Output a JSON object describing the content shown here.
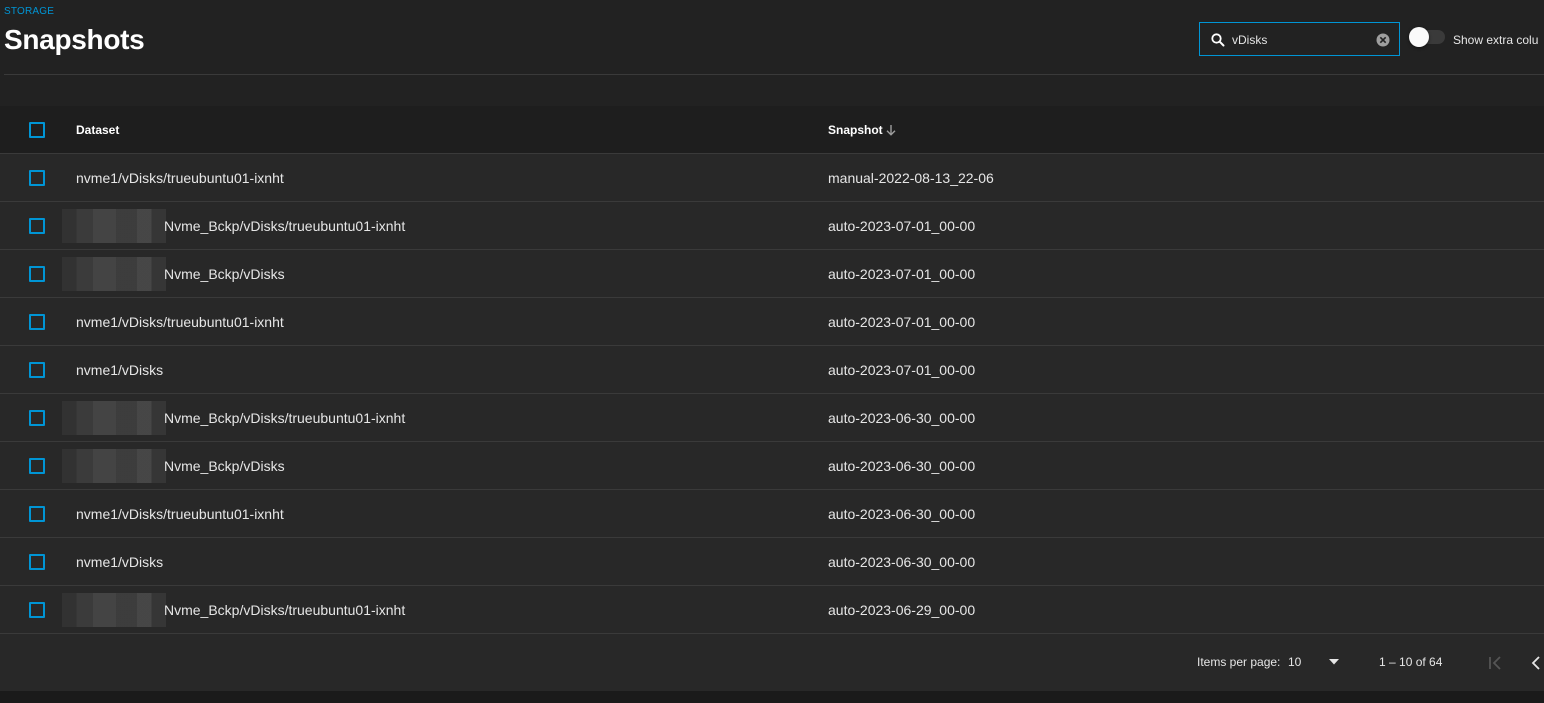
{
  "header": {
    "breadcrumb": "STORAGE",
    "title": "Snapshots"
  },
  "search": {
    "value": "vDisks",
    "placeholder": "Search"
  },
  "toggle": {
    "label": "Show extra colu",
    "checked": false
  },
  "table": {
    "columns": {
      "dataset": "Dataset",
      "snapshot": "Snapshot"
    },
    "sort": {
      "column": "Snapshot",
      "direction": "descending"
    },
    "rows": [
      {
        "dataset": "nvme1/vDisks/trueubuntu01-ixnht",
        "snapshot": "manual-2022-08-13_22-06",
        "redacted_prefix": false
      },
      {
        "dataset": "Nvme_Bckp/vDisks/trueubuntu01-ixnht",
        "snapshot": "auto-2023-07-01_00-00",
        "redacted_prefix": true
      },
      {
        "dataset": "Nvme_Bckp/vDisks",
        "snapshot": "auto-2023-07-01_00-00",
        "redacted_prefix": true
      },
      {
        "dataset": "nvme1/vDisks/trueubuntu01-ixnht",
        "snapshot": "auto-2023-07-01_00-00",
        "redacted_prefix": false
      },
      {
        "dataset": "nvme1/vDisks",
        "snapshot": "auto-2023-07-01_00-00",
        "redacted_prefix": false
      },
      {
        "dataset": "Nvme_Bckp/vDisks/trueubuntu01-ixnht",
        "snapshot": "auto-2023-06-30_00-00",
        "redacted_prefix": true
      },
      {
        "dataset": "Nvme_Bckp/vDisks",
        "snapshot": "auto-2023-06-30_00-00",
        "redacted_prefix": true
      },
      {
        "dataset": "nvme1/vDisks/trueubuntu01-ixnht",
        "snapshot": "auto-2023-06-30_00-00",
        "redacted_prefix": false
      },
      {
        "dataset": "nvme1/vDisks",
        "snapshot": "auto-2023-06-30_00-00",
        "redacted_prefix": false
      },
      {
        "dataset": "Nvme_Bckp/vDisks/trueubuntu01-ixnht",
        "snapshot": "auto-2023-06-29_00-00",
        "redacted_prefix": true
      }
    ]
  },
  "paginator": {
    "items_per_page_label": "Items per page:",
    "items_per_page_value": "10",
    "range_label": "1 – 10 of 64"
  },
  "colors": {
    "accent": "#0095d5",
    "background": "#222222",
    "table_background": "#282828",
    "header_background": "#1e1e1e",
    "text": "#e6e6e6"
  },
  "icons": {
    "search": "search-icon",
    "clear": "clear-icon",
    "sort": "arrow-down-icon",
    "dropdown": "dropdown-arrow-icon",
    "first_page": "first-page-icon",
    "previous_page": "previous-page-icon"
  }
}
